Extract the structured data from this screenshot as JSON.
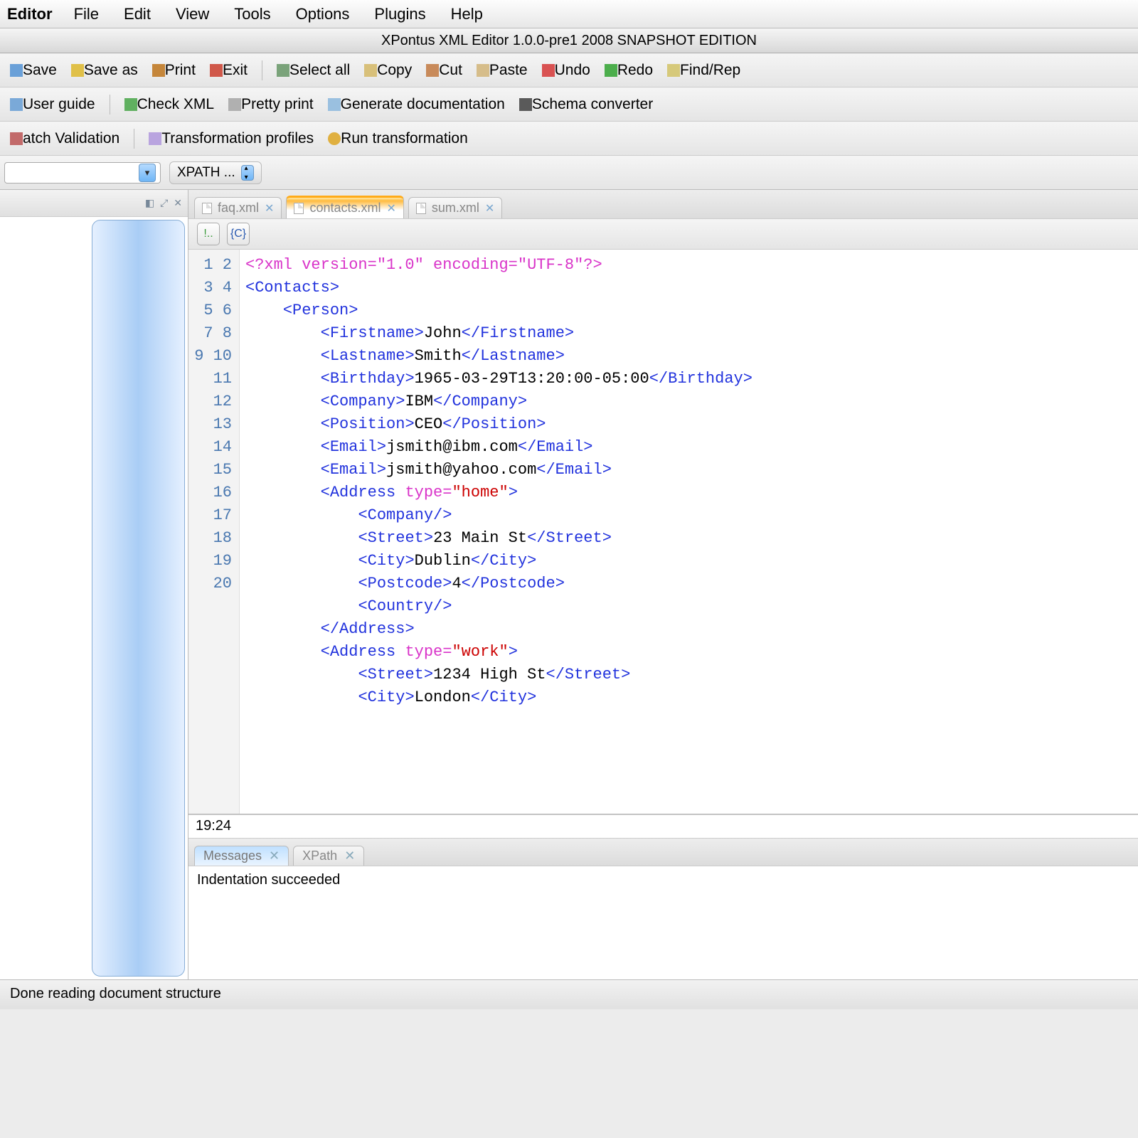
{
  "menubar": {
    "app": "Editor",
    "items": [
      "File",
      "Edit",
      "View",
      "Tools",
      "Options",
      "Plugins",
      "Help"
    ]
  },
  "window_title": "XPontus XML Editor 1.0.0-pre1 2008 SNAPSHOT EDITION",
  "toolbar1": {
    "save": "Save",
    "save_as": "Save as",
    "print": "Print",
    "exit": "Exit",
    "select_all": "Select all",
    "copy": "Copy",
    "cut": "Cut",
    "paste": "Paste",
    "undo": "Undo",
    "redo": "Redo",
    "find": "Find/Rep"
  },
  "toolbar2": {
    "user_guide": "User guide",
    "check_xml": "Check XML",
    "pretty_print": "Pretty print",
    "gen_doc": "Generate documentation",
    "schema_conv": "Schema converter"
  },
  "toolbar3": {
    "batch": "atch Validation",
    "profiles": "Transformation profiles",
    "run": "Run transformation"
  },
  "xpath_label": "XPATH ...",
  "file_tabs": [
    {
      "name": "faq.xml",
      "active": false
    },
    {
      "name": "contacts.xml",
      "active": true
    },
    {
      "name": "sum.xml",
      "active": false
    }
  ],
  "code_lines": [
    {
      "n": 1,
      "pi": "<?xml version=\"1.0\" encoding=\"UTF-8\"?>"
    },
    {
      "n": 2,
      "open": "Contacts"
    },
    {
      "n": 3,
      "indent": 1,
      "open": "Person"
    },
    {
      "n": 4,
      "indent": 2,
      "elem": "Firstname",
      "text": "John"
    },
    {
      "n": 5,
      "indent": 2,
      "elem": "Lastname",
      "text": "Smith"
    },
    {
      "n": 6,
      "indent": 2,
      "elem": "Birthday",
      "text": "1965-03-29T13:20:00-05:00"
    },
    {
      "n": 7,
      "indent": 2,
      "elem": "Company",
      "text": "IBM"
    },
    {
      "n": 8,
      "indent": 2,
      "elem": "Position",
      "text": "CEO"
    },
    {
      "n": 9,
      "indent": 2,
      "elem": "Email",
      "text": "jsmith@ibm.com"
    },
    {
      "n": 10,
      "indent": 2,
      "elem": "Email",
      "text": "jsmith@yahoo.com"
    },
    {
      "n": 11,
      "indent": 2,
      "openattr": "Address",
      "attr": "type",
      "val": "home"
    },
    {
      "n": 12,
      "indent": 3,
      "selfclose": "Company"
    },
    {
      "n": 13,
      "indent": 3,
      "elem": "Street",
      "text": "23 Main St"
    },
    {
      "n": 14,
      "indent": 3,
      "elem": "City",
      "text": "Dublin"
    },
    {
      "n": 15,
      "indent": 3,
      "elem": "Postcode",
      "text": "4"
    },
    {
      "n": 16,
      "indent": 3,
      "selfclose": "Country"
    },
    {
      "n": 17,
      "indent": 2,
      "close": "Address"
    },
    {
      "n": 18,
      "indent": 2,
      "openattr": "Address",
      "attr": "type",
      "val": "work"
    },
    {
      "n": 19,
      "indent": 3,
      "elem": "Street",
      "text": "1234 High St"
    },
    {
      "n": 20,
      "indent": 3,
      "elem": "City",
      "text": "London"
    }
  ],
  "cursor_pos": "19:24",
  "bottom_tabs": [
    {
      "name": "Messages",
      "active": true
    },
    {
      "name": "XPath",
      "active": false
    }
  ],
  "message_text": "Indentation succeeded",
  "status_text": "Done reading document structure"
}
